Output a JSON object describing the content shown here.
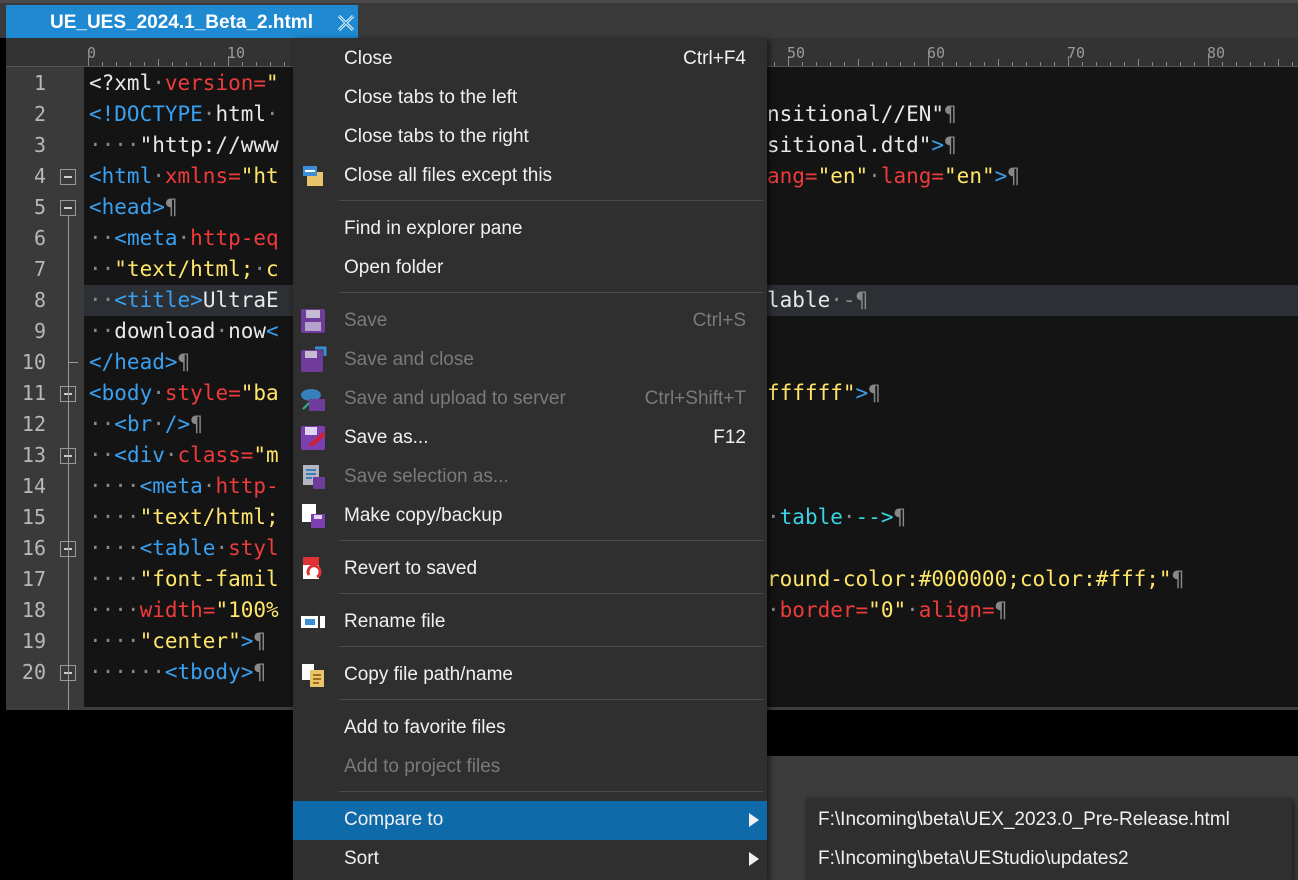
{
  "tab": {
    "title": "UE_UES_2024.1_Beta_2.html",
    "active_color": "#1f8ad2"
  },
  "ruler": {
    "labels": [
      "0",
      "10",
      "50",
      "60",
      "70",
      "80"
    ]
  },
  "editor": {
    "line_numbers": [
      "1",
      "2",
      "3",
      "4",
      "5",
      "6",
      "7",
      "8",
      "9",
      "10",
      "11",
      "12",
      "13",
      "14",
      "15",
      "16",
      "17",
      "18",
      "19",
      "20"
    ],
    "left_fragments": [
      [
        [
          "txt",
          "<?xml"
        ],
        [
          "dot",
          "·"
        ],
        [
          "attr",
          "version="
        ],
        [
          "str",
          "\""
        ]
      ],
      [
        [
          "tag",
          "<!DOCTYPE"
        ],
        [
          "dot",
          "·"
        ],
        [
          "txt",
          "html"
        ],
        [
          "dot",
          "·"
        ]
      ],
      [
        [
          "dot",
          "····"
        ],
        [
          "txt",
          "\"http://www"
        ]
      ],
      [
        [
          "tag",
          "<html"
        ],
        [
          "dot",
          "·"
        ],
        [
          "attr",
          "xmlns="
        ],
        [
          "str",
          "\"ht"
        ]
      ],
      [
        [
          "tag",
          "<head>"
        ],
        [
          "dot",
          "¶"
        ]
      ],
      [
        [
          "dot",
          "··"
        ],
        [
          "tag",
          "<meta"
        ],
        [
          "dot",
          "·"
        ],
        [
          "attr",
          "http-eq"
        ]
      ],
      [
        [
          "dot",
          "··"
        ],
        [
          "str",
          "\"text/html;"
        ],
        [
          "dot",
          "·"
        ],
        [
          "str",
          "c"
        ]
      ],
      [
        [
          "dot",
          "··"
        ],
        [
          "tag",
          "<title>"
        ],
        [
          "txt",
          "UltraE"
        ]
      ],
      [
        [
          "dot",
          "··"
        ],
        [
          "txt",
          "download"
        ],
        [
          "dot",
          "·"
        ],
        [
          "txt",
          "now"
        ],
        [
          "tag",
          "<"
        ]
      ],
      [
        [
          "tag",
          "</head>"
        ],
        [
          "dot",
          "¶"
        ]
      ],
      [
        [
          "tag",
          "<body"
        ],
        [
          "dot",
          "·"
        ],
        [
          "attr",
          "style="
        ],
        [
          "str",
          "\"ba"
        ]
      ],
      [
        [
          "dot",
          "··"
        ],
        [
          "tag",
          "<br"
        ],
        [
          "dot",
          "·"
        ],
        [
          "tag",
          "/>"
        ],
        [
          "dot",
          "¶"
        ]
      ],
      [
        [
          "dot",
          "··"
        ],
        [
          "tag",
          "<div"
        ],
        [
          "dot",
          "·"
        ],
        [
          "attr",
          "class="
        ],
        [
          "str",
          "\"m"
        ]
      ],
      [
        [
          "dot",
          "····"
        ],
        [
          "tag",
          "<meta"
        ],
        [
          "dot",
          "·"
        ],
        [
          "attr",
          "http-"
        ]
      ],
      [
        [
          "dot",
          "····"
        ],
        [
          "str",
          "\"text/html;"
        ]
      ],
      [
        [
          "dot",
          "····"
        ],
        [
          "tag",
          "<table"
        ],
        [
          "dot",
          "·"
        ],
        [
          "attr",
          "styl"
        ]
      ],
      [
        [
          "dot",
          "····"
        ],
        [
          "str",
          "\"font-famil"
        ]
      ],
      [
        [
          "dot",
          "····"
        ],
        [
          "attr",
          "width="
        ],
        [
          "str",
          "\"100%"
        ]
      ],
      [
        [
          "dot",
          "····"
        ],
        [
          "str",
          "\"center\""
        ],
        [
          "tag",
          ">"
        ],
        [
          "dot",
          "¶"
        ]
      ],
      [
        [
          "dot",
          "······"
        ],
        [
          "tag",
          "<tbody>"
        ],
        [
          "dot",
          "¶"
        ]
      ]
    ],
    "right_fragments": [
      [],
      [
        [
          "txt",
          "nsitional//EN\""
        ],
        [
          "dot",
          "¶"
        ]
      ],
      [
        [
          "txt",
          "sitional.dtd\""
        ],
        [
          "tag",
          ">"
        ],
        [
          "dot",
          "¶"
        ]
      ],
      [
        [
          "attr",
          "ang="
        ],
        [
          "str",
          "\"en\""
        ],
        [
          "dot",
          "·"
        ],
        [
          "attr",
          "lang="
        ],
        [
          "str",
          "\"en\""
        ],
        [
          "tag",
          ">"
        ],
        [
          "dot",
          "¶"
        ]
      ],
      [],
      [],
      [],
      [
        [
          "txt",
          "lable"
        ],
        [
          "dot",
          "·-¶"
        ]
      ],
      [],
      [],
      [
        [
          "str",
          "ffffff\""
        ],
        [
          "tag",
          ">"
        ],
        [
          "dot",
          "¶"
        ]
      ],
      [],
      [],
      [],
      [
        [
          "dot",
          "·"
        ],
        [
          "cmt",
          "table"
        ],
        [
          "dot",
          "·"
        ],
        [
          "cmt",
          "-->"
        ],
        [
          "dot",
          "¶"
        ]
      ],
      [],
      [
        [
          "str",
          "round-color:#000000;color:#fff;\""
        ],
        [
          "dot",
          "¶"
        ]
      ],
      [
        [
          "dot",
          "·"
        ],
        [
          "attr",
          "border="
        ],
        [
          "str",
          "\"0\""
        ],
        [
          "dot",
          "·"
        ],
        [
          "attr",
          "align="
        ],
        [
          "dot",
          "¶"
        ]
      ],
      [],
      []
    ]
  },
  "context_menu": {
    "items": [
      {
        "label": "Close",
        "shortcut": "Ctrl+F4",
        "icon": "",
        "disabled": false
      },
      {
        "label": "Close tabs to the left",
        "shortcut": "",
        "icon": "",
        "disabled": false
      },
      {
        "label": "Close tabs to the right",
        "shortcut": "",
        "icon": "",
        "disabled": false
      },
      {
        "label": "Close all files except this",
        "shortcut": "",
        "icon": "close-all-files-icon",
        "disabled": false
      },
      {
        "label": "Find in explorer pane",
        "shortcut": "",
        "icon": "",
        "disabled": false
      },
      {
        "label": "Open folder",
        "shortcut": "",
        "icon": "",
        "disabled": false
      },
      {
        "label": "Save",
        "shortcut": "Ctrl+S",
        "icon": "floppy-disk-icon",
        "disabled": true
      },
      {
        "label": "Save and close",
        "shortcut": "",
        "icon": "save-and-close-icon",
        "disabled": true
      },
      {
        "label": "Save and upload to server",
        "shortcut": "Ctrl+Shift+T",
        "icon": "cloud-upload-icon",
        "disabled": true
      },
      {
        "label": "Save as...",
        "shortcut": "F12",
        "icon": "save-as-icon",
        "disabled": false
      },
      {
        "label": "Save selection as...",
        "shortcut": "",
        "icon": "save-selection-icon",
        "disabled": true
      },
      {
        "label": "Make copy/backup",
        "shortcut": "",
        "icon": "copy-backup-icon",
        "disabled": false
      },
      {
        "label": "Revert to saved",
        "shortcut": "",
        "icon": "revert-icon",
        "disabled": false
      },
      {
        "label": "Rename file",
        "shortcut": "",
        "icon": "rename-icon",
        "disabled": false
      },
      {
        "label": "Copy file path/name",
        "shortcut": "",
        "icon": "copy-path-icon",
        "disabled": false
      },
      {
        "label": "Add to favorite files",
        "shortcut": "",
        "icon": "",
        "disabled": false
      },
      {
        "label": "Add to project files",
        "shortcut": "",
        "icon": "",
        "disabled": true
      },
      {
        "label": "Compare to",
        "shortcut": "",
        "icon": "",
        "disabled": false,
        "submenu": true,
        "selected": true
      },
      {
        "label": "Sort",
        "shortcut": "",
        "icon": "",
        "disabled": false,
        "submenu": true
      }
    ]
  },
  "compare_submenu": {
    "items": [
      {
        "label": "F:\\Incoming\\beta\\UEX_2023.0_Pre-Release.html"
      },
      {
        "label": "F:\\Incoming\\beta\\UEStudio\\updates2"
      }
    ]
  },
  "colors": {
    "accent": "#1f8ad2",
    "menu_selected": "#0e6aa8",
    "tag": "#3aa0f0",
    "attr": "#ee3b3b",
    "string": "#ffe66a",
    "comment": "#39d3e3"
  }
}
